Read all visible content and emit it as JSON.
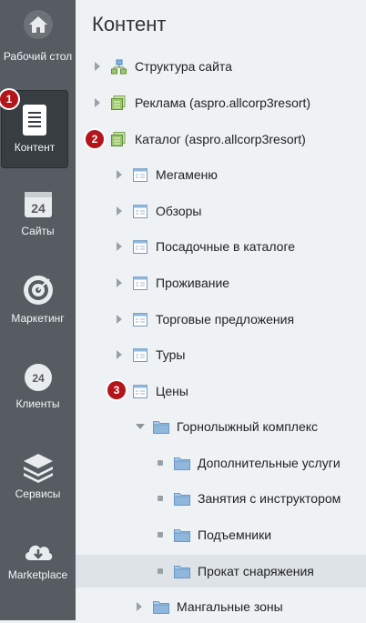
{
  "sidebar": {
    "items": [
      {
        "label": "Рабочий стол",
        "icon": "house-icon"
      },
      {
        "label": "Контент",
        "icon": "document-icon"
      },
      {
        "label": "Сайты",
        "icon": "calendar-24-icon"
      },
      {
        "label": "Маркетинг",
        "icon": "target-icon"
      },
      {
        "label": "Клиенты",
        "icon": "clock-24-icon"
      },
      {
        "label": "Сервисы",
        "icon": "layers-icon"
      },
      {
        "label": "Marketplace",
        "icon": "cloud-download-icon"
      }
    ]
  },
  "page": {
    "title": "Контент"
  },
  "tree": [
    {
      "label": "Структура сайта",
      "icon": "site-structure-icon"
    },
    {
      "label": "Реклама (aspro.allcorp3resort)",
      "icon": "iblock-type-icon"
    },
    {
      "label": "Каталог (aspro.allcorp3resort)",
      "icon": "iblock-type-icon"
    },
    {
      "label": "Мегаменю",
      "icon": "iblock-icon"
    },
    {
      "label": "Обзоры",
      "icon": "iblock-icon"
    },
    {
      "label": "Посадочные в каталоге",
      "icon": "iblock-icon"
    },
    {
      "label": "Проживание",
      "icon": "iblock-icon"
    },
    {
      "label": "Торговые предложения",
      "icon": "iblock-icon"
    },
    {
      "label": "Туры",
      "icon": "iblock-icon"
    },
    {
      "label": "Цены",
      "icon": "iblock-icon"
    },
    {
      "label": "Горнолыжный комплекс",
      "icon": "folder-icon"
    },
    {
      "label": "Дополнительные услуги",
      "icon": "folder-icon"
    },
    {
      "label": "Занятия с инструктором",
      "icon": "folder-icon"
    },
    {
      "label": "Подъемники",
      "icon": "folder-icon"
    },
    {
      "label": "Прокат снаряжения",
      "icon": "folder-icon"
    },
    {
      "label": "Мангальные зоны",
      "icon": "folder-icon"
    }
  ],
  "badges": [
    "1",
    "2",
    "3"
  ],
  "colors": {
    "sidebar": "#565c62",
    "sidebar_active": "#383d42",
    "badge": "#b3151b",
    "folder": "#8fb7de",
    "iblock_green": "#9ac769"
  }
}
